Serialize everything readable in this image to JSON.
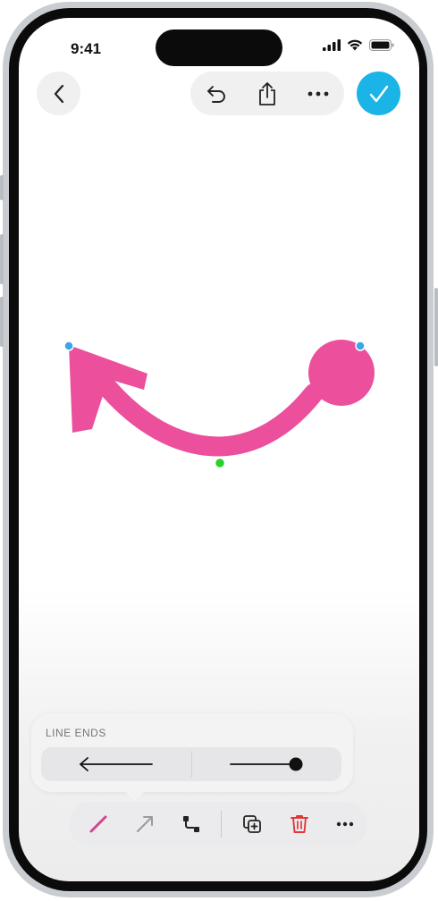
{
  "status_bar": {
    "time": "9:41"
  },
  "top_bar": {
    "back_icon": "chevron-left-icon",
    "undo_icon": "undo-icon",
    "share_icon": "share-icon",
    "more_icon": "ellipsis-icon",
    "done_icon": "checkmark-icon"
  },
  "canvas": {
    "shape": "curved-line",
    "stroke_color": "#ec4f9c",
    "start_end": "arrow",
    "end_end": "dot"
  },
  "popover": {
    "title": "LINE ENDS",
    "options": [
      {
        "icon": "arrow-left-icon"
      },
      {
        "icon": "line-dot-icon"
      }
    ]
  },
  "toolbar": {
    "items": [
      {
        "icon": "pen-stroke-icon"
      },
      {
        "icon": "arrow-stroke-icon"
      },
      {
        "icon": "connection-line-icon"
      },
      {
        "icon": "duplicate-icon"
      },
      {
        "icon": "trash-icon"
      },
      {
        "icon": "ellipsis-icon"
      }
    ]
  },
  "colors": {
    "accent": "#1bb4e6",
    "stroke": "#ec4f9c",
    "delete": "#e0393a",
    "handle_edit": "#3aa8e5",
    "handle_curve": "#2bd12b"
  }
}
